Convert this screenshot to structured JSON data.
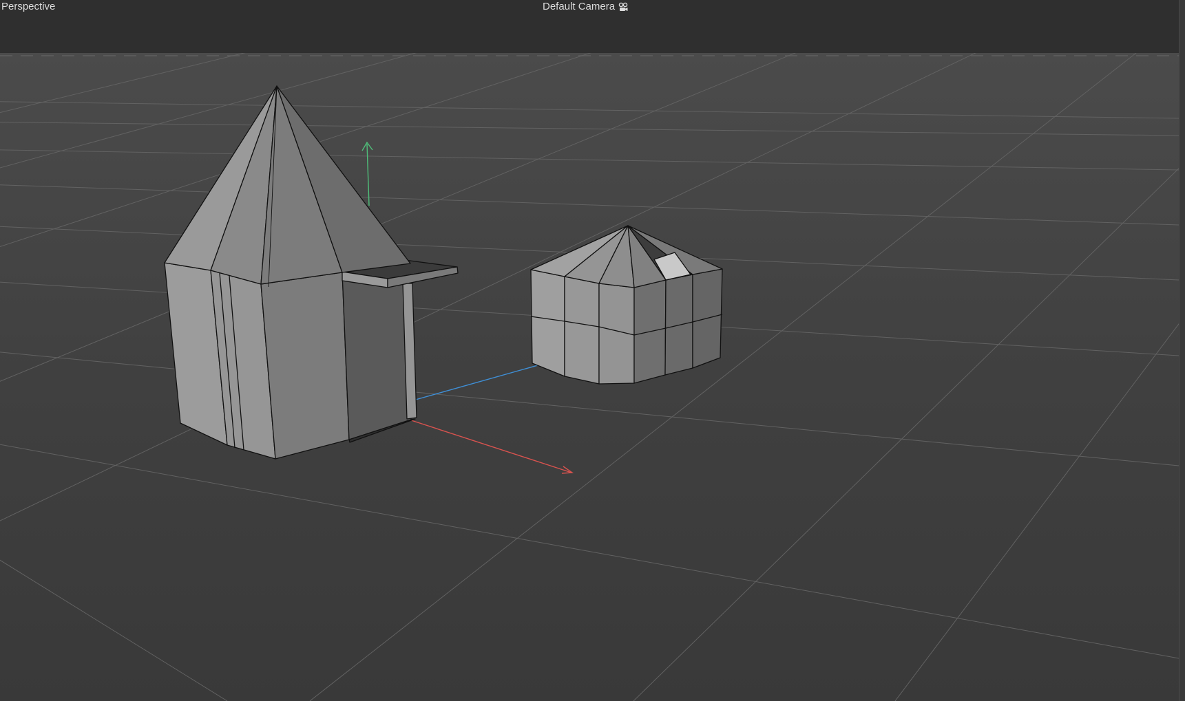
{
  "viewport": {
    "view_label": "Perspective",
    "camera_label": "Default Camera"
  },
  "icons": {
    "camera": "camera-icon"
  },
  "colors": {
    "background_top": "#4b4b4b",
    "background_bottom": "#3a3a3a",
    "grid_line": "#5c5c5c",
    "mesh_light": "#9d9d9d",
    "mesh_mid": "#8e8e8e",
    "mesh_dark": "#707070",
    "mesh_darkest": "#3c3c3c",
    "edge": "#111111",
    "axis_x": "#d9534f",
    "axis_y": "#4fbf7a",
    "axis_z": "#3f8fd6"
  }
}
